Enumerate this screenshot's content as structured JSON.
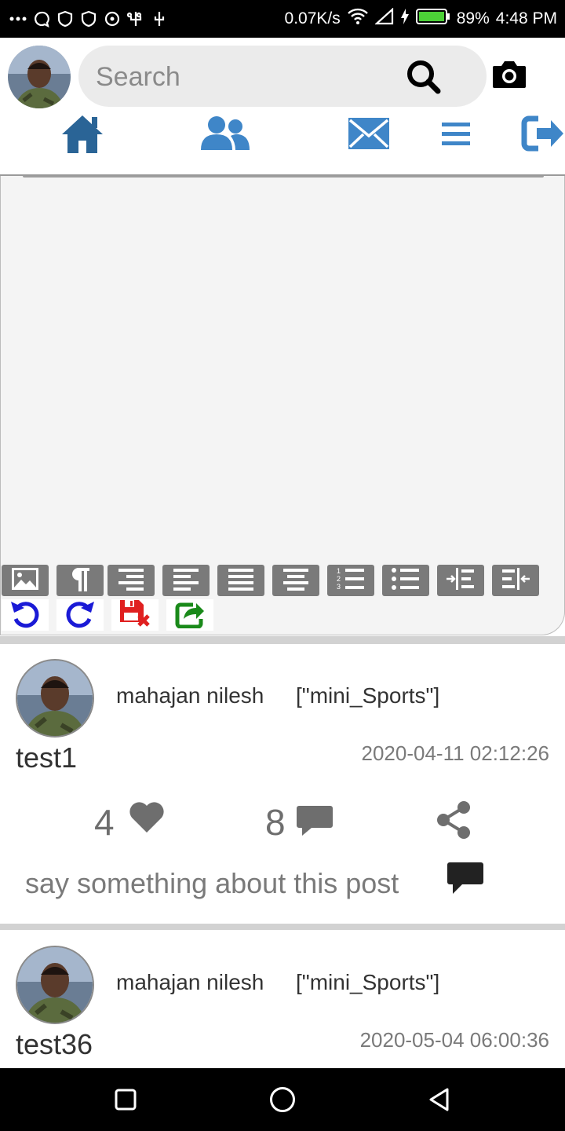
{
  "status_bar": {
    "speed": "0.07K/s",
    "battery": "89%",
    "time": "4:48 PM"
  },
  "header": {
    "search_placeholder": "Search"
  },
  "nav": {
    "icons": [
      "home-icon",
      "friends-icon",
      "messages-icon",
      "menu-icon",
      "logout-icon"
    ]
  },
  "editor": {
    "toolbar_icons": [
      "image-icon",
      "paragraph-icon",
      "align-right-icon",
      "align-left-icon",
      "justify-icon",
      "align-center-icon",
      "ordered-list-icon",
      "unordered-list-icon",
      "indent-icon",
      "outdent-icon"
    ],
    "action_icons": [
      "undo-icon",
      "redo-icon",
      "discard-icon",
      "share-post-icon"
    ]
  },
  "posts": [
    {
      "author": "mahajan nilesh",
      "category": "[\"mini_Sports\"]",
      "title": "test1",
      "date": "2020-04-11 02:12:26",
      "likes": "4",
      "comments": "8",
      "comment_placeholder": "say something about this post"
    },
    {
      "author": "mahajan nilesh",
      "category": "[\"mini_Sports\"]",
      "title": "test36",
      "date": "2020-05-04 06:00:36"
    }
  ],
  "colors": {
    "nav_blue": "#3f86c8",
    "home_blue": "#2a6496",
    "toolbar_gray": "#7a7a7a",
    "undo_blue": "#1a1ad6",
    "discard_red": "#e02020",
    "share_green": "#1a8a1a"
  }
}
